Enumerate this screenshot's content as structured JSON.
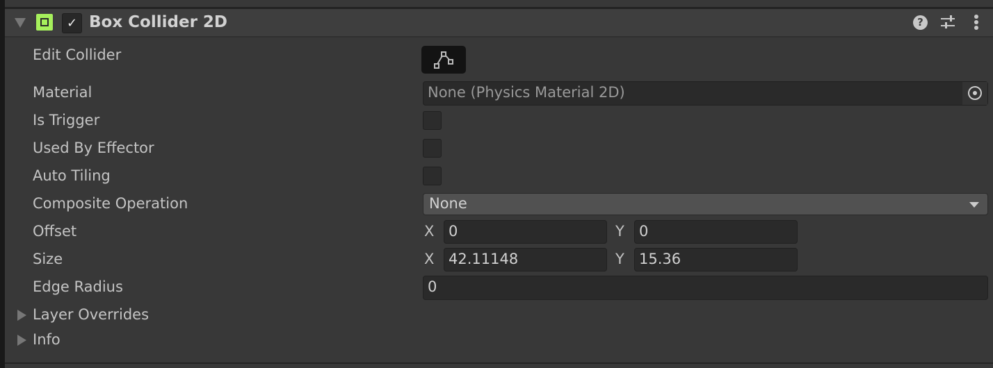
{
  "component": {
    "title": "Box Collider 2D",
    "enabled": true
  },
  "header_icons": [
    "help-icon",
    "presets-icon",
    "more-icon"
  ],
  "rows": {
    "edit_collider": "Edit Collider",
    "material": "Material",
    "material_value": "None (Physics Material 2D)",
    "is_trigger": "Is Trigger",
    "used_by_effector": "Used By Effector",
    "auto_tiling": "Auto Tiling",
    "composite_operation": "Composite Operation",
    "composite_value": "None",
    "offset": "Offset",
    "offset_x": "0",
    "offset_y": "0",
    "size": "Size",
    "size_x": "42.11148",
    "size_y": "15.36",
    "edge_radius": "Edge Radius",
    "edge_radius_value": "0",
    "layer_overrides": "Layer Overrides",
    "info": "Info"
  },
  "axis": {
    "x": "X",
    "y": "Y"
  },
  "colors": {
    "accent_green": "#a6f05c"
  }
}
